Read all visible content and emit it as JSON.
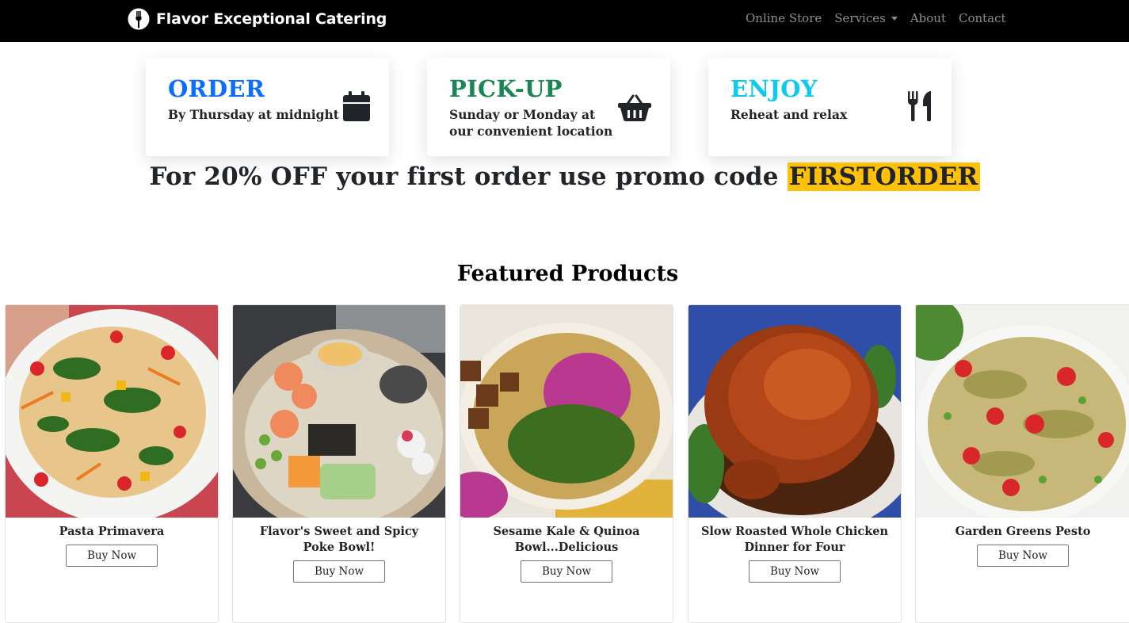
{
  "brand": {
    "name": "Flavor Exceptional Catering"
  },
  "nav": [
    {
      "label": "Online Store"
    },
    {
      "label": "Services"
    },
    {
      "label": "About"
    },
    {
      "label": "Contact"
    }
  ],
  "steps": [
    {
      "title": "ORDER",
      "subtitle": "By Thursday at midnight",
      "color": "#0d6efd",
      "icon": "calendar-icon"
    },
    {
      "title": "PICK-UP",
      "subtitle_line1": "Sunday or Monday at",
      "subtitle_line2": "our convenient location",
      "color": "#198754",
      "icon": "basket-icon"
    },
    {
      "title": "ENJOY",
      "subtitle": "Reheat and relax",
      "color": "#0dcaf0",
      "icon": "utensils-icon"
    }
  ],
  "promo": {
    "text": "For 20% OFF your first order use promo code ",
    "code": "FIRSTORDER",
    "highlight_color": "#ffc107"
  },
  "featured": {
    "title": "Featured Products",
    "products": [
      {
        "name": "Pasta Primavera",
        "button": "Buy Now"
      },
      {
        "name": "Flavor's Sweet and Spicy Poke Bowl!",
        "button": "Buy Now"
      },
      {
        "name": "Sesame Kale & Quinoa Bowl...Delicious",
        "button": "Buy Now"
      },
      {
        "name": "Slow Roasted Whole Chicken Dinner for Four",
        "button": "Buy Now"
      },
      {
        "name": "Garden Greens Pesto",
        "button": "Buy Now"
      }
    ]
  }
}
